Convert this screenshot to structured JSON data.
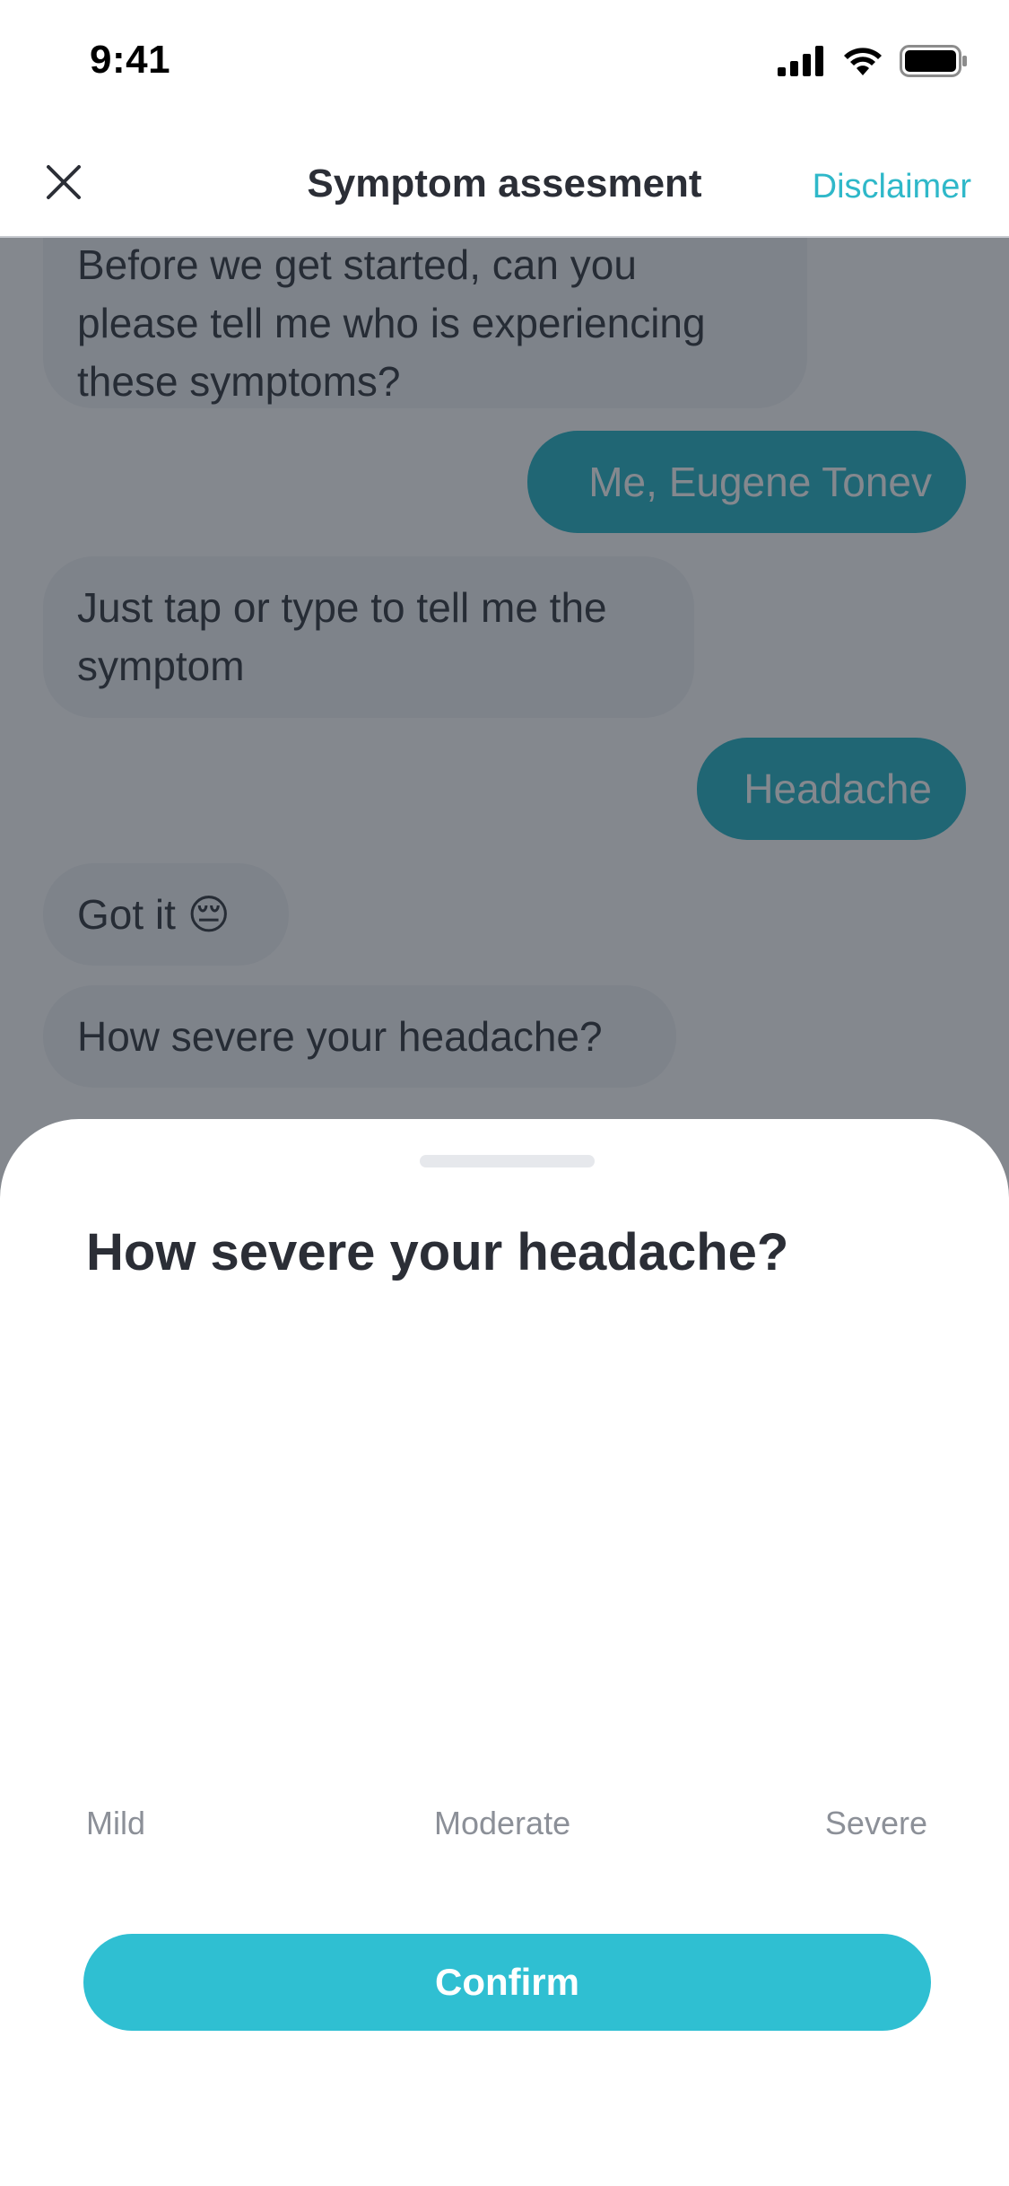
{
  "status_bar": {
    "time": "9:41",
    "icons": [
      "signal-icon",
      "wifi-icon",
      "battery-icon"
    ]
  },
  "header": {
    "close_icon": "close-icon",
    "title": "Symptom assesment",
    "disclaimer_label": "Disclaimer"
  },
  "chat": {
    "messages": [
      {
        "sender": "bot",
        "text_lines": [
          "Before we get started, can you",
          "please tell me who is experiencing",
          "these symptoms?"
        ]
      },
      {
        "sender": "user",
        "text": "Me, Eugene Tonev"
      },
      {
        "sender": "bot",
        "text_lines": [
          "Just tap or type to tell me the",
          "symptom"
        ]
      },
      {
        "sender": "user",
        "text": "Headache"
      },
      {
        "sender": "bot",
        "text": "Got it",
        "emoji": "😔"
      },
      {
        "sender": "bot",
        "text": "How severe your headache?"
      }
    ]
  },
  "sheet": {
    "title": "How severe your headache?",
    "scale_labels": [
      "Mild",
      "Moderate",
      "Severe"
    ],
    "confirm_label": "Confirm"
  },
  "colors": {
    "accent": "#2FBFD2",
    "link": "#2FB8C9",
    "bot_bubble": "#F3F4F7",
    "text_dark": "#2B2E36",
    "muted": "#8C9098"
  }
}
